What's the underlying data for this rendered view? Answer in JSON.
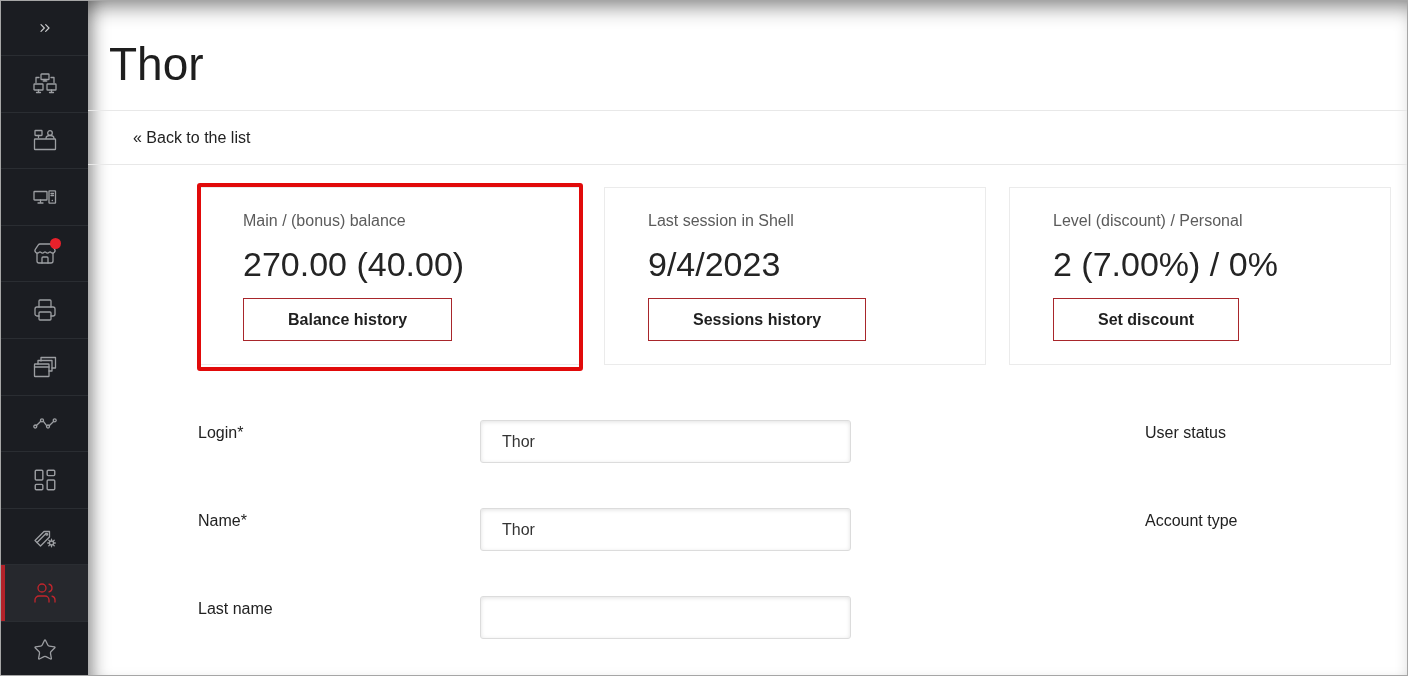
{
  "sidebar": {
    "items": [
      {
        "selected": false,
        "notification": false
      },
      {
        "selected": false,
        "notification": false
      },
      {
        "selected": false,
        "notification": false
      },
      {
        "selected": false,
        "notification": true
      },
      {
        "selected": false,
        "notification": false
      },
      {
        "selected": false,
        "notification": false
      },
      {
        "selected": false,
        "notification": false
      },
      {
        "selected": false,
        "notification": false
      },
      {
        "selected": false,
        "notification": false
      },
      {
        "selected": true,
        "notification": false
      },
      {
        "selected": false,
        "notification": false
      }
    ]
  },
  "page": {
    "title": "Thor",
    "back_link": "« Back to the list"
  },
  "cards": [
    {
      "label": "Main / (bonus) balance",
      "value": "270.00 (40.00)",
      "button": "Balance history",
      "highlighted": true
    },
    {
      "label": "Last session in Shell",
      "value": "9/4/2023",
      "button": "Sessions history",
      "highlighted": false
    },
    {
      "label": "Level (discount) / Personal",
      "value": "2 (7.00%) / 0%",
      "button": "Set discount",
      "highlighted": false
    }
  ],
  "form": {
    "fields": [
      {
        "label": "Login*",
        "value": "Thor"
      },
      {
        "label": "Name*",
        "value": "Thor"
      },
      {
        "label": "Last name"
      }
    ],
    "side_labels": [
      "User status",
      "Account type"
    ]
  }
}
